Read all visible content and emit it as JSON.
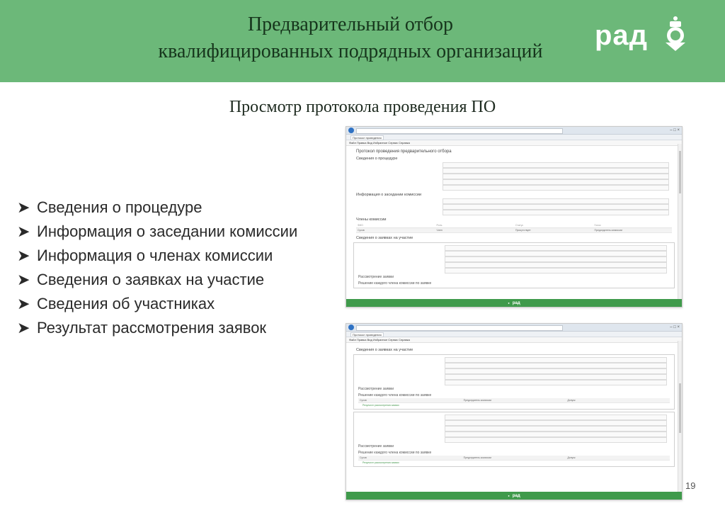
{
  "header": {
    "title_line1": "Предварительный отбор",
    "title_line2": "квалифицированных подрядных организаций",
    "logo_text": "рад",
    "bg_color": "#6cb879"
  },
  "subtitle": "Просмотр протокола проведения ПО",
  "bullets": [
    {
      "text": "Сведения о процедуре"
    },
    {
      "text": "Информация о заседании комиссии"
    },
    {
      "text": "Информация о членах комиссии"
    },
    {
      "text": "Сведения о заявках на участие"
    },
    {
      "text": "Сведения об участниках"
    },
    {
      "text": "Результат рассмотрения заявок"
    }
  ],
  "page_number": "19",
  "screenshot1": {
    "menu": "Файл  Правка  Вид  Избранное  Сервис  Справка",
    "tab_label": "Протокол проведения",
    "doc_title": "Протокол проведения предварительного отбора",
    "sec_procedure": "Сведения о процедуре",
    "sec_meeting": "Информация о заседании комиссии",
    "sec_members": "Члены комиссии",
    "members_header": [
      "ФИО",
      "Роль",
      "Статус",
      "Голос"
    ],
    "members_row": [
      "Сухов",
      "Член",
      "Присутствует",
      "Председатель комиссии"
    ],
    "sec_applications": "Сведения о заявках на участие",
    "review_label": "Рассмотрение заявки",
    "decision_label": "Решение каждого члена комиссии по заявке",
    "footer_logo": "рад"
  },
  "screenshot2": {
    "menu": "Файл  Правка  Вид  Избранное  Сервис  Справка",
    "tab_label": "Протокол проведения",
    "sec_applications": "Сведения о заявках на участие",
    "review_label": "Рассмотрение заявки",
    "decision_label": "Решение каждого члена комиссии по заявке",
    "decision_row": [
      "Сухов",
      "Председатель комиссии",
      "Допуск"
    ],
    "link_text": "Результат рассмотрения заявки",
    "footer_logo": "рад"
  }
}
